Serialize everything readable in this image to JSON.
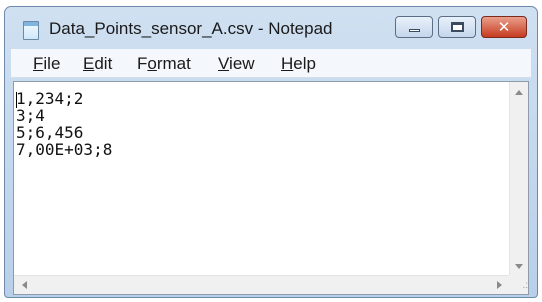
{
  "window": {
    "title": "Data_Points_sensor_A.csv - Notepad",
    "icon": "notepad-icon"
  },
  "menu": [
    {
      "label_first": "F",
      "label_rest": "ile"
    },
    {
      "label_first": "E",
      "label_rest": "dit"
    },
    {
      "label_first": "F",
      "label_rest": "ormat",
      "underline_index": 1
    },
    {
      "label_first": "V",
      "label_rest": "iew"
    },
    {
      "label_first": "H",
      "label_rest": "elp"
    }
  ],
  "editor": {
    "content": "1,234;2\n3;4\n5;6,456\n7,00E+03;8"
  },
  "colors": {
    "titlebar": "#cfe0f1",
    "close_button": "#c63c20"
  }
}
